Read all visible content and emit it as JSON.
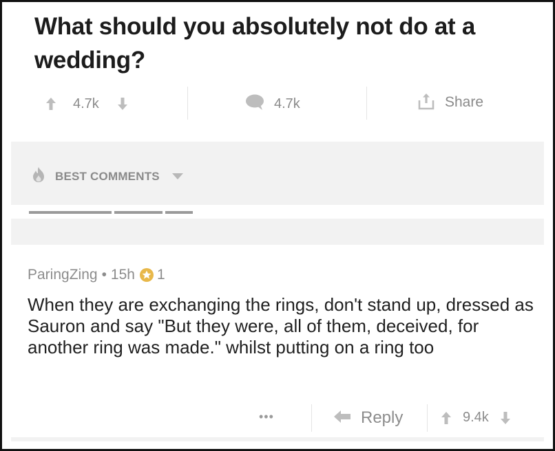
{
  "post": {
    "title": "What should you absolutely not do at a wedding?",
    "votes": "4.7k",
    "comments": "4.7k",
    "share_label": "Share"
  },
  "sort": {
    "label": "BEST COMMENTS"
  },
  "comment": {
    "author": "ParingZing",
    "separator": "•",
    "age": "15h",
    "award_count": "1",
    "body": "When they are exchanging the rings, don't stand up, dressed as Sauron and say \"But they were, all of them, deceived, for another ring was made.\" whilst putting on a ring too",
    "more_label": "•••",
    "reply_label": "Reply",
    "votes": "9.4k"
  },
  "colors": {
    "icon_gray": "#bdbdbd",
    "text_gray": "#8a8a8a",
    "band_gray": "#f2f2f2",
    "award_gold": "#e8b84a"
  }
}
